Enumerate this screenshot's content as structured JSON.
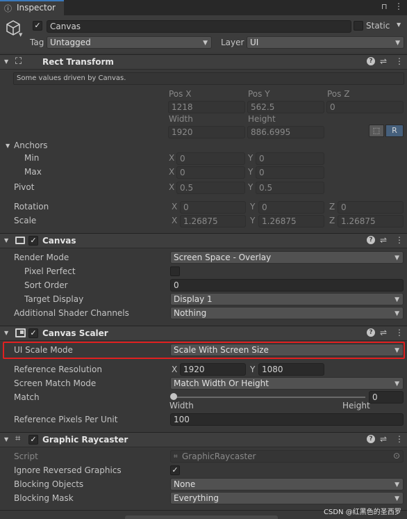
{
  "tab": {
    "title": "Inspector"
  },
  "object": {
    "name": "Canvas",
    "active": true,
    "static_label": "Static",
    "tag_label": "Tag",
    "tag_value": "Untagged",
    "layer_label": "Layer",
    "layer_value": "UI"
  },
  "rect_transform": {
    "title": "Rect Transform",
    "info": "Some values driven by Canvas.",
    "pos_x_label": "Pos X",
    "pos_y_label": "Pos Y",
    "pos_z_label": "Pos Z",
    "pos_x": "1218",
    "pos_y": "562.5",
    "pos_z": "0",
    "width_label": "Width",
    "height_label": "Height",
    "width": "1920",
    "height": "886.6995",
    "r_button": "R",
    "anchors_label": "Anchors",
    "min_label": "Min",
    "max_label": "Max",
    "min_x": "0",
    "min_y": "0",
    "max_x": "0",
    "max_y": "0",
    "pivot_label": "Pivot",
    "pivot_x": "0.5",
    "pivot_y": "0.5",
    "rotation_label": "Rotation",
    "rot_x": "0",
    "rot_y": "0",
    "rot_z": "0",
    "scale_label": "Scale",
    "scale_x": "1.26875",
    "scale_y": "1.26875",
    "scale_z": "1.26875",
    "x": "X",
    "y": "Y",
    "z": "Z"
  },
  "canvas": {
    "title": "Canvas",
    "enabled": true,
    "render_mode_label": "Render Mode",
    "render_mode": "Screen Space - Overlay",
    "pixel_perfect_label": "Pixel Perfect",
    "pixel_perfect": false,
    "sort_order_label": "Sort Order",
    "sort_order": "0",
    "target_display_label": "Target Display",
    "target_display": "Display 1",
    "shader_channels_label": "Additional Shader Channels",
    "shader_channels": "Nothing"
  },
  "canvas_scaler": {
    "title": "Canvas Scaler",
    "enabled": true,
    "ui_scale_mode_label": "UI Scale Mode",
    "ui_scale_mode": "Scale With Screen Size",
    "ref_res_label": "Reference Resolution",
    "ref_x": "1920",
    "ref_y": "1080",
    "match_mode_label": "Screen Match Mode",
    "match_mode": "Match Width Or Height",
    "match_label": "Match",
    "match_value": "0",
    "match_fraction": 0,
    "width_label": "Width",
    "height_label": "Height",
    "ppu_label": "Reference Pixels Per Unit",
    "ppu": "100",
    "highlight_color": "#e02020"
  },
  "raycaster": {
    "title": "Graphic Raycaster",
    "enabled": true,
    "script_label": "Script",
    "script": "GraphicRaycaster",
    "ignore_reversed_label": "Ignore Reversed Graphics",
    "ignore_reversed": true,
    "blocking_objects_label": "Blocking Objects",
    "blocking_objects": "None",
    "blocking_mask_label": "Blocking Mask",
    "blocking_mask": "Everything"
  },
  "watermark": "CSDN @红黑色的圣西罗",
  "glyphs": {
    "check": "✓",
    "arrow": "▼",
    "fold": "▼",
    "help": "?",
    "menu": "⋮",
    "presets": "⇌",
    "lock": "🔒",
    "target": "⊙"
  }
}
